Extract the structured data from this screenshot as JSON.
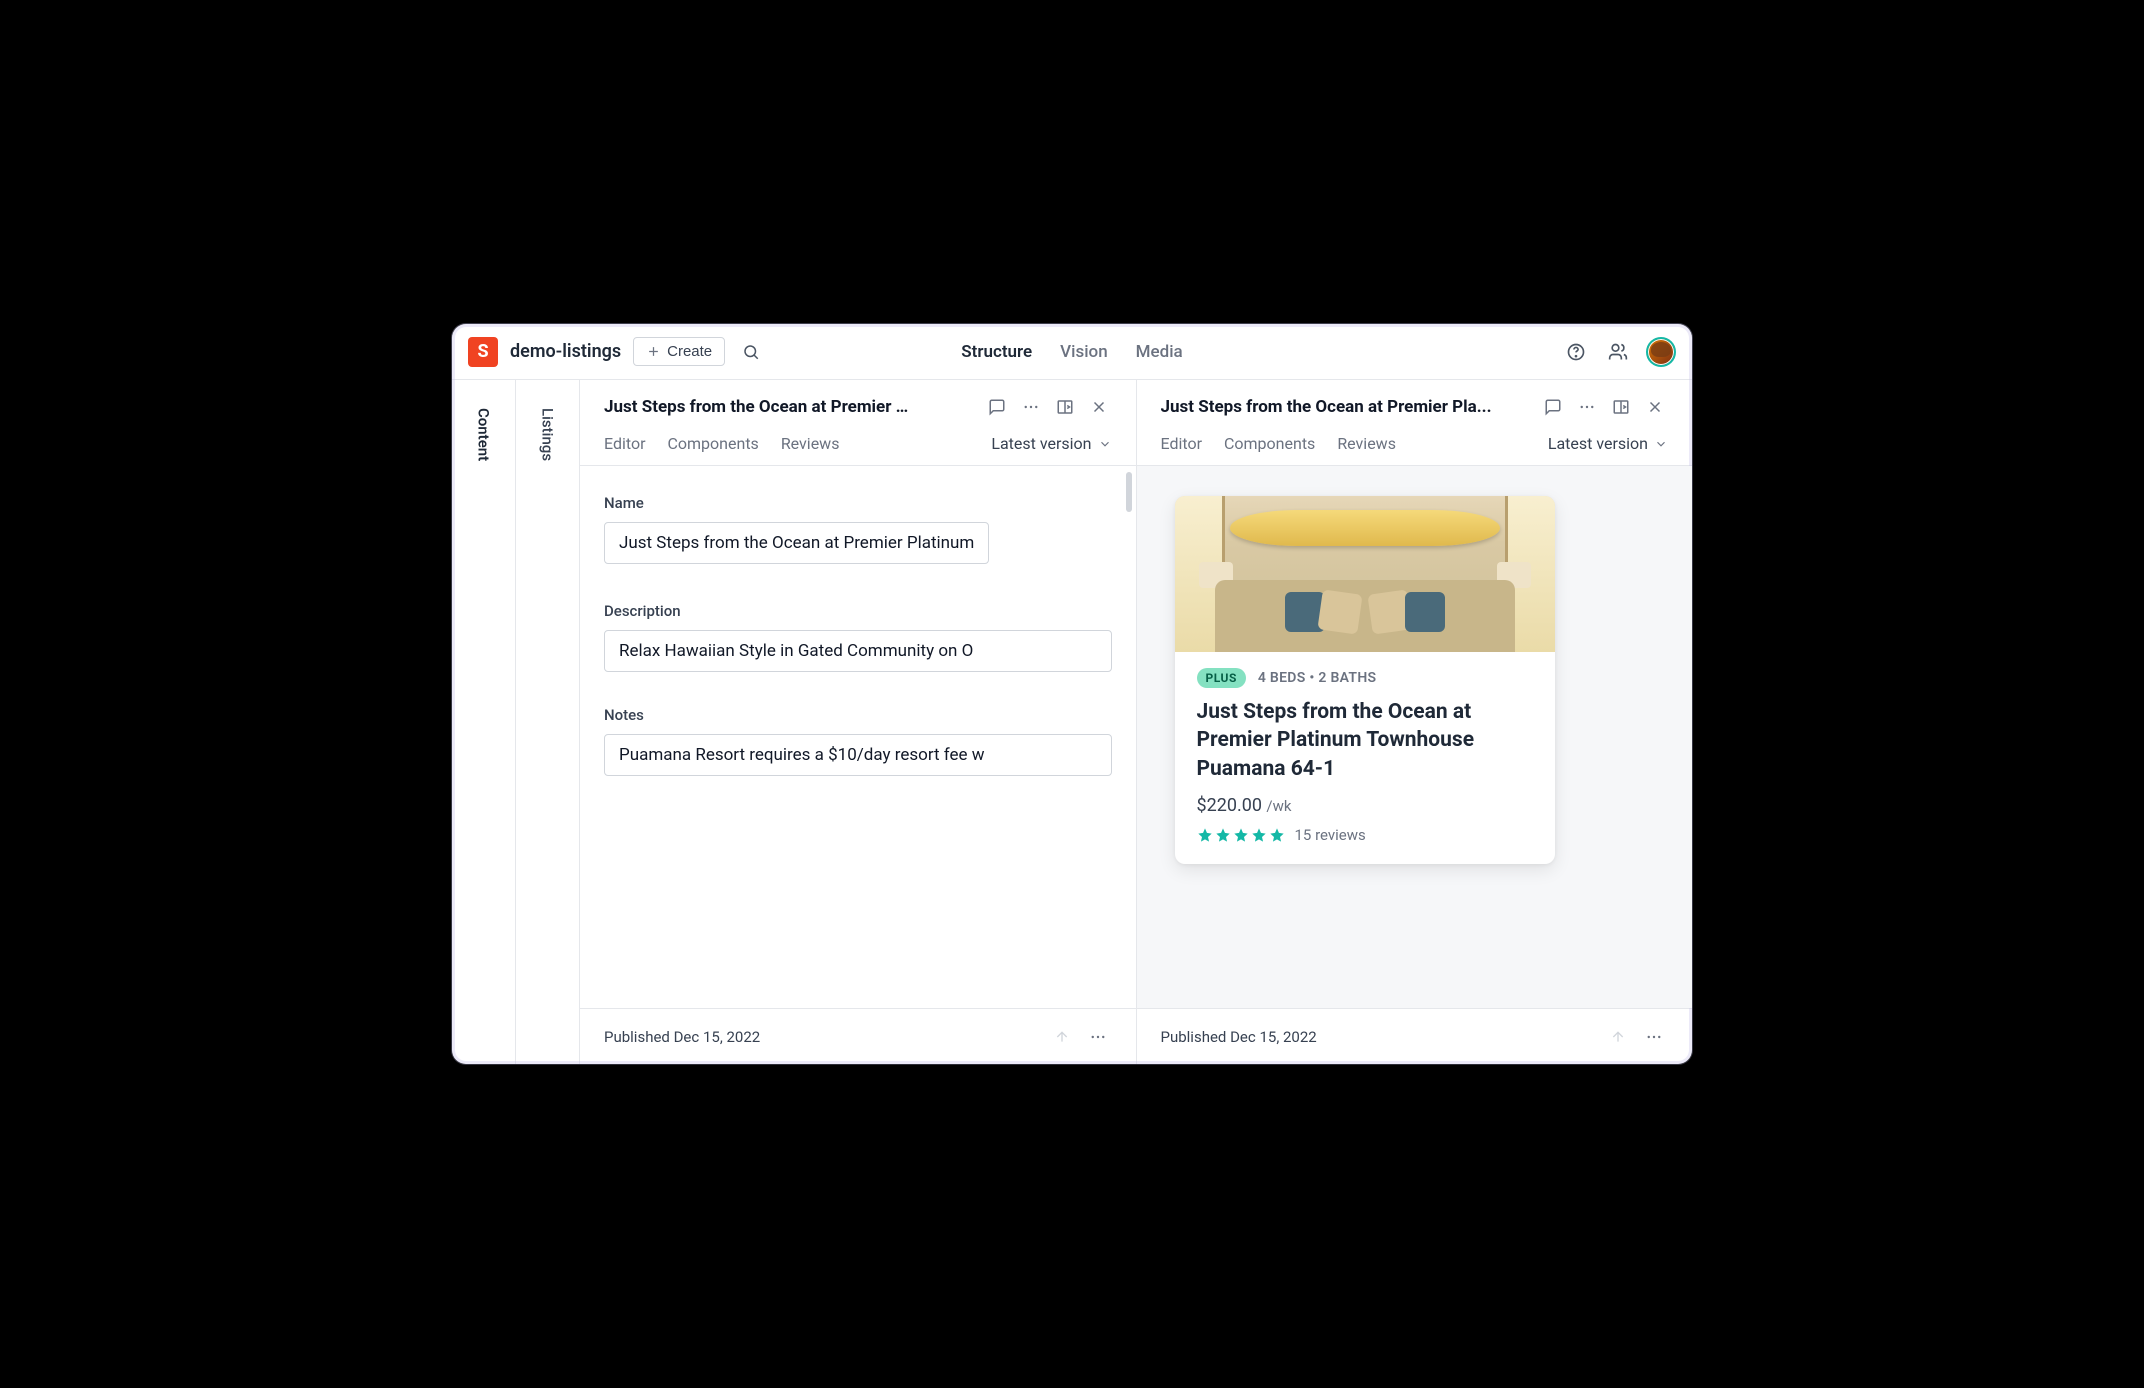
{
  "header": {
    "logo_letter": "S",
    "project": "demo-listings",
    "create_label": "Create",
    "nav": {
      "structure": "Structure",
      "vision": "Vision",
      "media": "Media"
    }
  },
  "sidebar": {
    "tabs": [
      "Content",
      "Listings"
    ]
  },
  "pane_left": {
    "title": "Just Steps from the Ocean at Premier …",
    "tabs": {
      "editor": "Editor",
      "components": "Components",
      "reviews": "Reviews"
    },
    "version": "Latest version",
    "fields": {
      "name": {
        "label": "Name",
        "value": "Just Steps from the Ocean at Premier Platinum"
      },
      "description": {
        "label": "Description",
        "value": "Relax Hawaiian Style in Gated Community on O"
      },
      "notes": {
        "label": "Notes",
        "value": "Puamana Resort requires a $10/day resort fee w"
      }
    },
    "footer": "Published Dec 15, 2022"
  },
  "pane_right": {
    "title": "Just Steps from the Ocean at Premier Pla...",
    "tabs": {
      "editor": "Editor",
      "components": "Components",
      "reviews": "Reviews"
    },
    "version": "Latest version",
    "footer": "Published Dec 15, 2022"
  },
  "preview": {
    "badge": "PLUS",
    "meta": "4 BEDS • 2 BATHS",
    "title": "Just Steps from the Ocean at Premier Platinum Townhouse Puamana 64-1",
    "price": "$220.00",
    "per": "/wk",
    "reviews": "15 reviews",
    "stars": 5
  }
}
